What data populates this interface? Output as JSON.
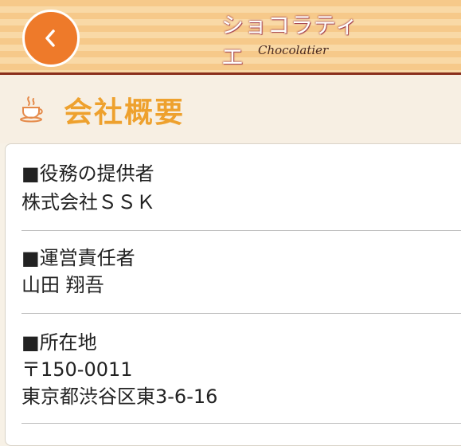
{
  "header": {
    "brand_jp": "ショコラティエ",
    "brand_en": "Chocolatier"
  },
  "page": {
    "title": "会社概要"
  },
  "sections": [
    {
      "heading": "■役務の提供者",
      "lines": [
        "株式会社ＳＳＫ"
      ]
    },
    {
      "heading": "■運営責任者",
      "lines": [
        "山田 翔吾"
      ]
    },
    {
      "heading": "■所在地",
      "lines": [
        "〒150-0011",
        "東京都渋谷区東3-6-16"
      ]
    }
  ],
  "colors": {
    "accent": "#ee7a2a",
    "title": "#eea12e",
    "header_border": "#8a2f1d"
  },
  "icons": {
    "back": "chevron-left-icon",
    "section": "coffee-cup-icon"
  }
}
